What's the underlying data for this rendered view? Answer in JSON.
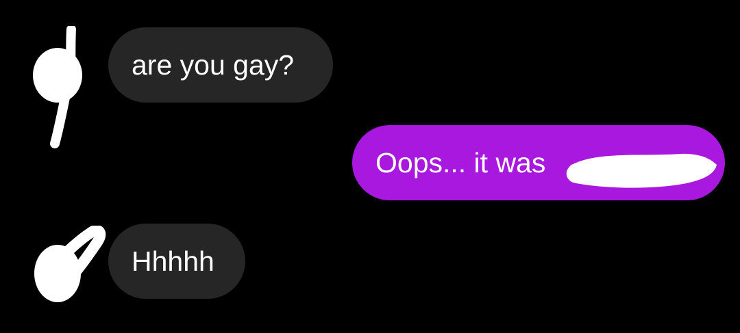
{
  "conversation": {
    "messages": [
      {
        "direction": "incoming",
        "text": "are you gay?"
      },
      {
        "direction": "outgoing",
        "text": "Oops... it was"
      },
      {
        "direction": "incoming",
        "text": "Hhhhh"
      }
    ]
  },
  "colors": {
    "background": "#000000",
    "incoming_bubble": "#262626",
    "outgoing_bubble": "#a818de",
    "text": "#ffffff",
    "redaction": "#ffffff"
  }
}
